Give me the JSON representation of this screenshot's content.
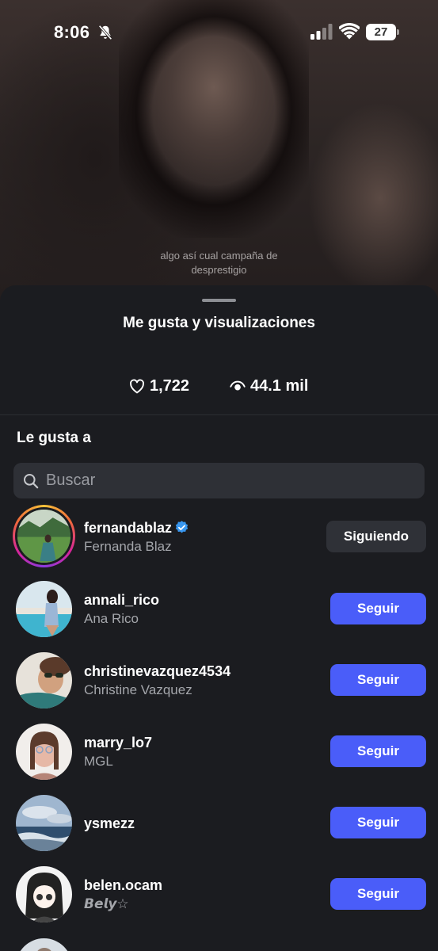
{
  "status_bar": {
    "time": "8:06",
    "battery": "27"
  },
  "video": {
    "caption_line1": "algo así cual campaña de",
    "caption_line2": "desprestigio"
  },
  "sheet": {
    "title": "Me gusta y visualizaciones",
    "likes": "1,722",
    "views": "44.1 mil",
    "section_title": "Le gusta a",
    "search_placeholder": "Buscar"
  },
  "users": [
    {
      "username": "fernandablaz",
      "fullname": "Fernanda Blaz",
      "verified": true,
      "button": "Siguiendo",
      "has_story": true
    },
    {
      "username": "annali_rico",
      "fullname": "Ana Rico",
      "verified": false,
      "button": "Seguir"
    },
    {
      "username": "christinevazquez4534",
      "fullname": "Christine Vazquez",
      "verified": false,
      "button": "Seguir"
    },
    {
      "username": "marry_lo7",
      "fullname": "MGL",
      "verified": false,
      "button": "Seguir"
    },
    {
      "username": "ysmezz",
      "fullname": "",
      "verified": false,
      "button": "Seguir"
    },
    {
      "username": "belen.ocam",
      "fullname": "𝘽𝙚𝙡𝙮☆",
      "verified": false,
      "button": "Seguir"
    }
  ],
  "colors": {
    "accent": "#4a5df9",
    "sheet_bg": "#1b1c20",
    "verified": "#3897f0"
  }
}
